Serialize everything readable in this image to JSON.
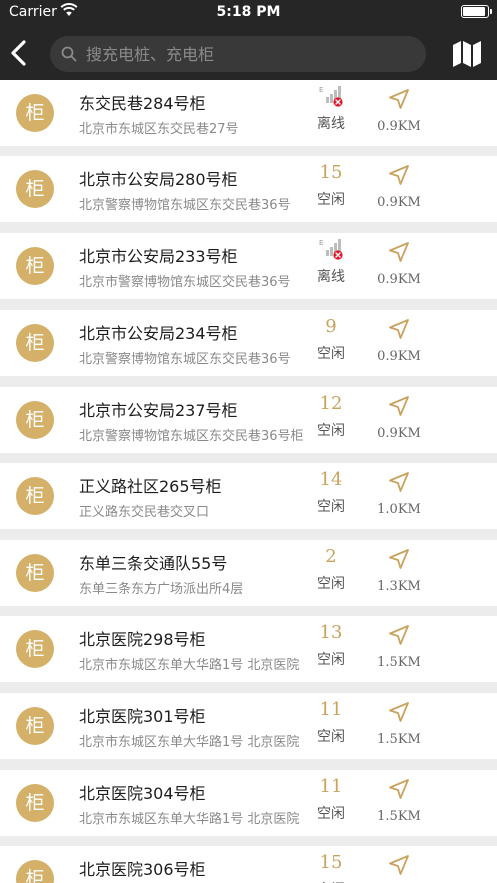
{
  "status_bar": {
    "carrier": "Carrier",
    "time": "5:18 PM"
  },
  "search": {
    "placeholder": "搜充电桩、充电柜"
  },
  "badge_label": "柜",
  "stations": [
    {
      "name": "东交民巷284号柜",
      "address": "北京市东城区东交民巷27号",
      "count": "",
      "state": "离线",
      "offline": true,
      "distance": "0.9KM"
    },
    {
      "name": "北京市公安局280号柜",
      "address": "北京警察博物馆东城区东交民巷36号",
      "count": "15",
      "state": "空闲",
      "offline": false,
      "distance": "0.9KM"
    },
    {
      "name": "北京市公安局233号柜",
      "address": "北京市警察博物馆东城区交民巷36号",
      "count": "",
      "state": "离线",
      "offline": true,
      "distance": "0.9KM"
    },
    {
      "name": "北京市公安局234号柜",
      "address": "北京警察博物馆东城区东交民巷36号",
      "count": "9",
      "state": "空闲",
      "offline": false,
      "distance": "0.9KM"
    },
    {
      "name": "北京市公安局237号柜",
      "address": "北京警察博物馆东城区东交民巷36号柜",
      "count": "12",
      "state": "空闲",
      "offline": false,
      "distance": "0.9KM"
    },
    {
      "name": "正义路社区265号柜",
      "address": "正义路东交民巷交叉口",
      "count": "14",
      "state": "空闲",
      "offline": false,
      "distance": "1.0KM"
    },
    {
      "name": "东单三条交通队55号",
      "address": "东单三条东方广场派出所4层",
      "count": "2",
      "state": "空闲",
      "offline": false,
      "distance": "1.3KM"
    },
    {
      "name": "北京医院298号柜",
      "address": "北京市东城区东单大华路1号 北京医院",
      "count": "13",
      "state": "空闲",
      "offline": false,
      "distance": "1.5KM"
    },
    {
      "name": "北京医院301号柜",
      "address": "北京市东城区东单大华路1号 北京医院",
      "count": "11",
      "state": "空闲",
      "offline": false,
      "distance": "1.5KM"
    },
    {
      "name": "北京医院304号柜",
      "address": "北京市东城区东单大华路1号 北京医院",
      "count": "11",
      "state": "空闲",
      "offline": false,
      "distance": "1.5KM"
    },
    {
      "name": "北京医院306号柜",
      "address": "",
      "count": "15",
      "state": "空闲",
      "offline": false,
      "distance": ""
    }
  ],
  "colors": {
    "accent": "#d4b069",
    "count": "#c9a35e",
    "topbar": "#262626",
    "offline_badge": "#e0162b"
  }
}
